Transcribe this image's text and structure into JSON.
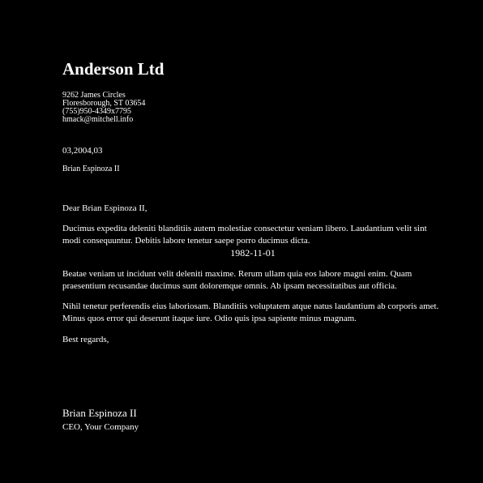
{
  "letterhead": {
    "company": "Anderson Ltd",
    "address_line1": "9262 James Circles",
    "address_line2": "Floresborough, ST 03654",
    "phone": "(755)950-4349x7795",
    "email": "hmack@mitchell.info"
  },
  "letter": {
    "date": "03,2004,03",
    "recipient": "Brian Espinoza II",
    "salutation": "Dear Brian Espinoza II,",
    "paragraph1": "Ducimus expedita deleniti blanditiis autem molestiae consectetur veniam libero. Laudantium velit sint modi consequuntur. Debitis labore tenetur saepe porro ducimus dicta.",
    "centered_date": "1982-11-01",
    "paragraph2": "Beatae veniam ut incidunt velit deleniti maxime. Rerum ullam quia eos labore magni enim. Quam praesentium recusandae ducimus sunt doloremque omnis. Ab ipsam necessitatibus aut officia.",
    "paragraph3": "Nihil tenetur perferendis eius laboriosam. Blanditiis voluptatem atque natus laudantium ab corporis amet. Minus quos error qui deserunt itaque iure. Odio quis ipsa sapiente minus magnam.",
    "closing": "Best regards,"
  },
  "signature": {
    "name": "Brian Espinoza II",
    "title": "CEO, Your Company"
  },
  "colors": {
    "background": "#000000",
    "text": "#ffffff"
  }
}
